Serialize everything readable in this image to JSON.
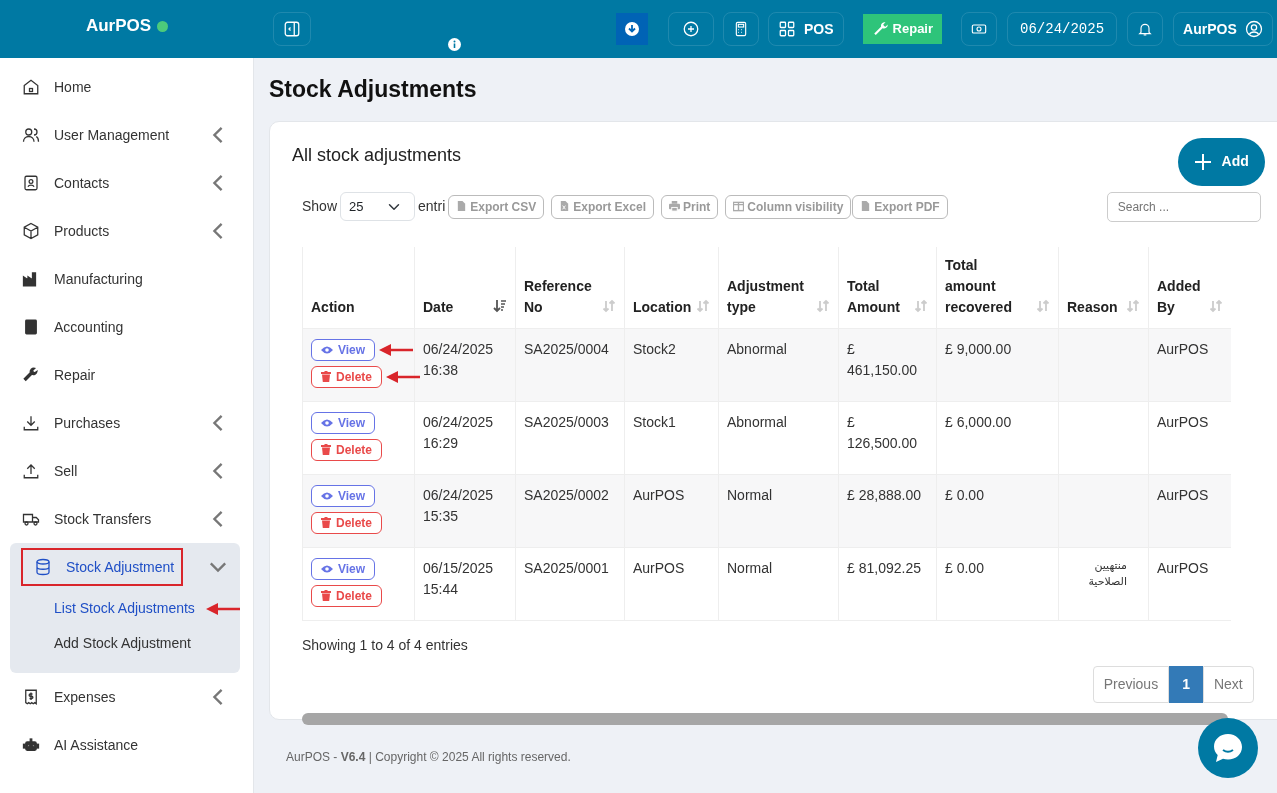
{
  "brand": {
    "name": "AurPOS",
    "online": true
  },
  "topbar": {
    "buttons": [
      {
        "kind": "add"
      },
      {
        "kind": "calculator"
      },
      {
        "kind": "pos",
        "label": "POS"
      },
      {
        "kind": "repair",
        "label": "Repair"
      },
      {
        "kind": "cash"
      },
      {
        "kind": "date",
        "label": "06/24/2025"
      },
      {
        "kind": "bell"
      },
      {
        "kind": "user",
        "label": "AurPOS"
      }
    ]
  },
  "sidebar": {
    "items": [
      {
        "label": "Home",
        "has_submenu": false
      },
      {
        "label": "User Management",
        "has_submenu": true
      },
      {
        "label": "Contacts",
        "has_submenu": true
      },
      {
        "label": "Products",
        "has_submenu": true
      },
      {
        "label": "Manufacturing",
        "has_submenu": false
      },
      {
        "label": "Accounting",
        "has_submenu": false
      },
      {
        "label": "Repair",
        "has_submenu": false
      },
      {
        "label": "Purchases",
        "has_submenu": true
      },
      {
        "label": "Sell",
        "has_submenu": true
      },
      {
        "label": "Stock Transfers",
        "has_submenu": true
      },
      {
        "label": "Stock Adjustment",
        "has_submenu": true,
        "expanded": true,
        "highlighted": true,
        "children": [
          {
            "label": "List Stock Adjustments",
            "selected": true,
            "arrow": true
          },
          {
            "label": "Add Stock Adjustment",
            "selected": false,
            "arrow": false
          }
        ]
      },
      {
        "label": "Expenses",
        "has_submenu": true
      },
      {
        "label": "AI Assistance",
        "has_submenu": false
      }
    ]
  },
  "page_title": "Stock Adjustments",
  "card": {
    "title": "All stock adjustments",
    "add_button": "Add",
    "show_label": "Show",
    "page_length": "25",
    "entries_label": "entri",
    "exports": [
      {
        "kind": "csv",
        "label": "Export CSV"
      },
      {
        "kind": "excel",
        "label": "Export Excel"
      },
      {
        "kind": "print",
        "label": "Print"
      },
      {
        "kind": "columns",
        "label": "Column visibility"
      },
      {
        "kind": "pdf",
        "label": "Export PDF"
      }
    ],
    "search": {
      "placeholder": "Search ..."
    },
    "table": {
      "columns": [
        {
          "label": "Action"
        },
        {
          "label": "Date"
        },
        {
          "label": "Reference No"
        },
        {
          "label": "Location"
        },
        {
          "label": "Adjustment type"
        },
        {
          "label": "Total Amount"
        },
        {
          "label": "Total amount recovered"
        },
        {
          "label": "Reason"
        },
        {
          "label": "Added By"
        }
      ],
      "rows": [
        {
          "view": "View",
          "delete": "Delete",
          "arrows": true,
          "cells": [
            "",
            "06/24/2025 16:38",
            "SA2025/0004",
            "Stock2",
            "Abnormal",
            "£ 461,150.00",
            "£ 9,000.00",
            "",
            "AurPOS"
          ]
        },
        {
          "view": "View",
          "delete": "Delete",
          "arrows": false,
          "cells": [
            "",
            "06/24/2025 16:29",
            "SA2025/0003",
            "Stock1",
            "Abnormal",
            "£ 126,500.00",
            "£ 6,000.00",
            "",
            "AurPOS"
          ]
        },
        {
          "view": "View",
          "delete": "Delete",
          "arrows": false,
          "cells": [
            "",
            "06/24/2025 15:35",
            "SA2025/0002",
            "AurPOS",
            "Normal",
            "£ 28,888.00",
            "£ 0.00",
            "",
            "AurPOS"
          ]
        },
        {
          "view": "View",
          "delete": "Delete",
          "arrows": false,
          "cells": [
            "",
            "06/15/2025 15:44",
            "SA2025/0001",
            "AurPOS",
            "Normal",
            "£ 81,092.25",
            "£ 0.00",
            "منتهيين الصلاحية",
            "AurPOS"
          ]
        }
      ]
    },
    "info": "Showing 1 to 4 of 4 entries",
    "pagination": [
      {
        "label": "Previous",
        "selected": false
      },
      {
        "label": "1",
        "selected": true
      },
      {
        "label": "Next",
        "selected": false
      }
    ]
  },
  "footer": {
    "brand": "AurPOS - ",
    "version": "V6.4",
    "rest": " | Copyright © 2025 All rights reserved."
  }
}
